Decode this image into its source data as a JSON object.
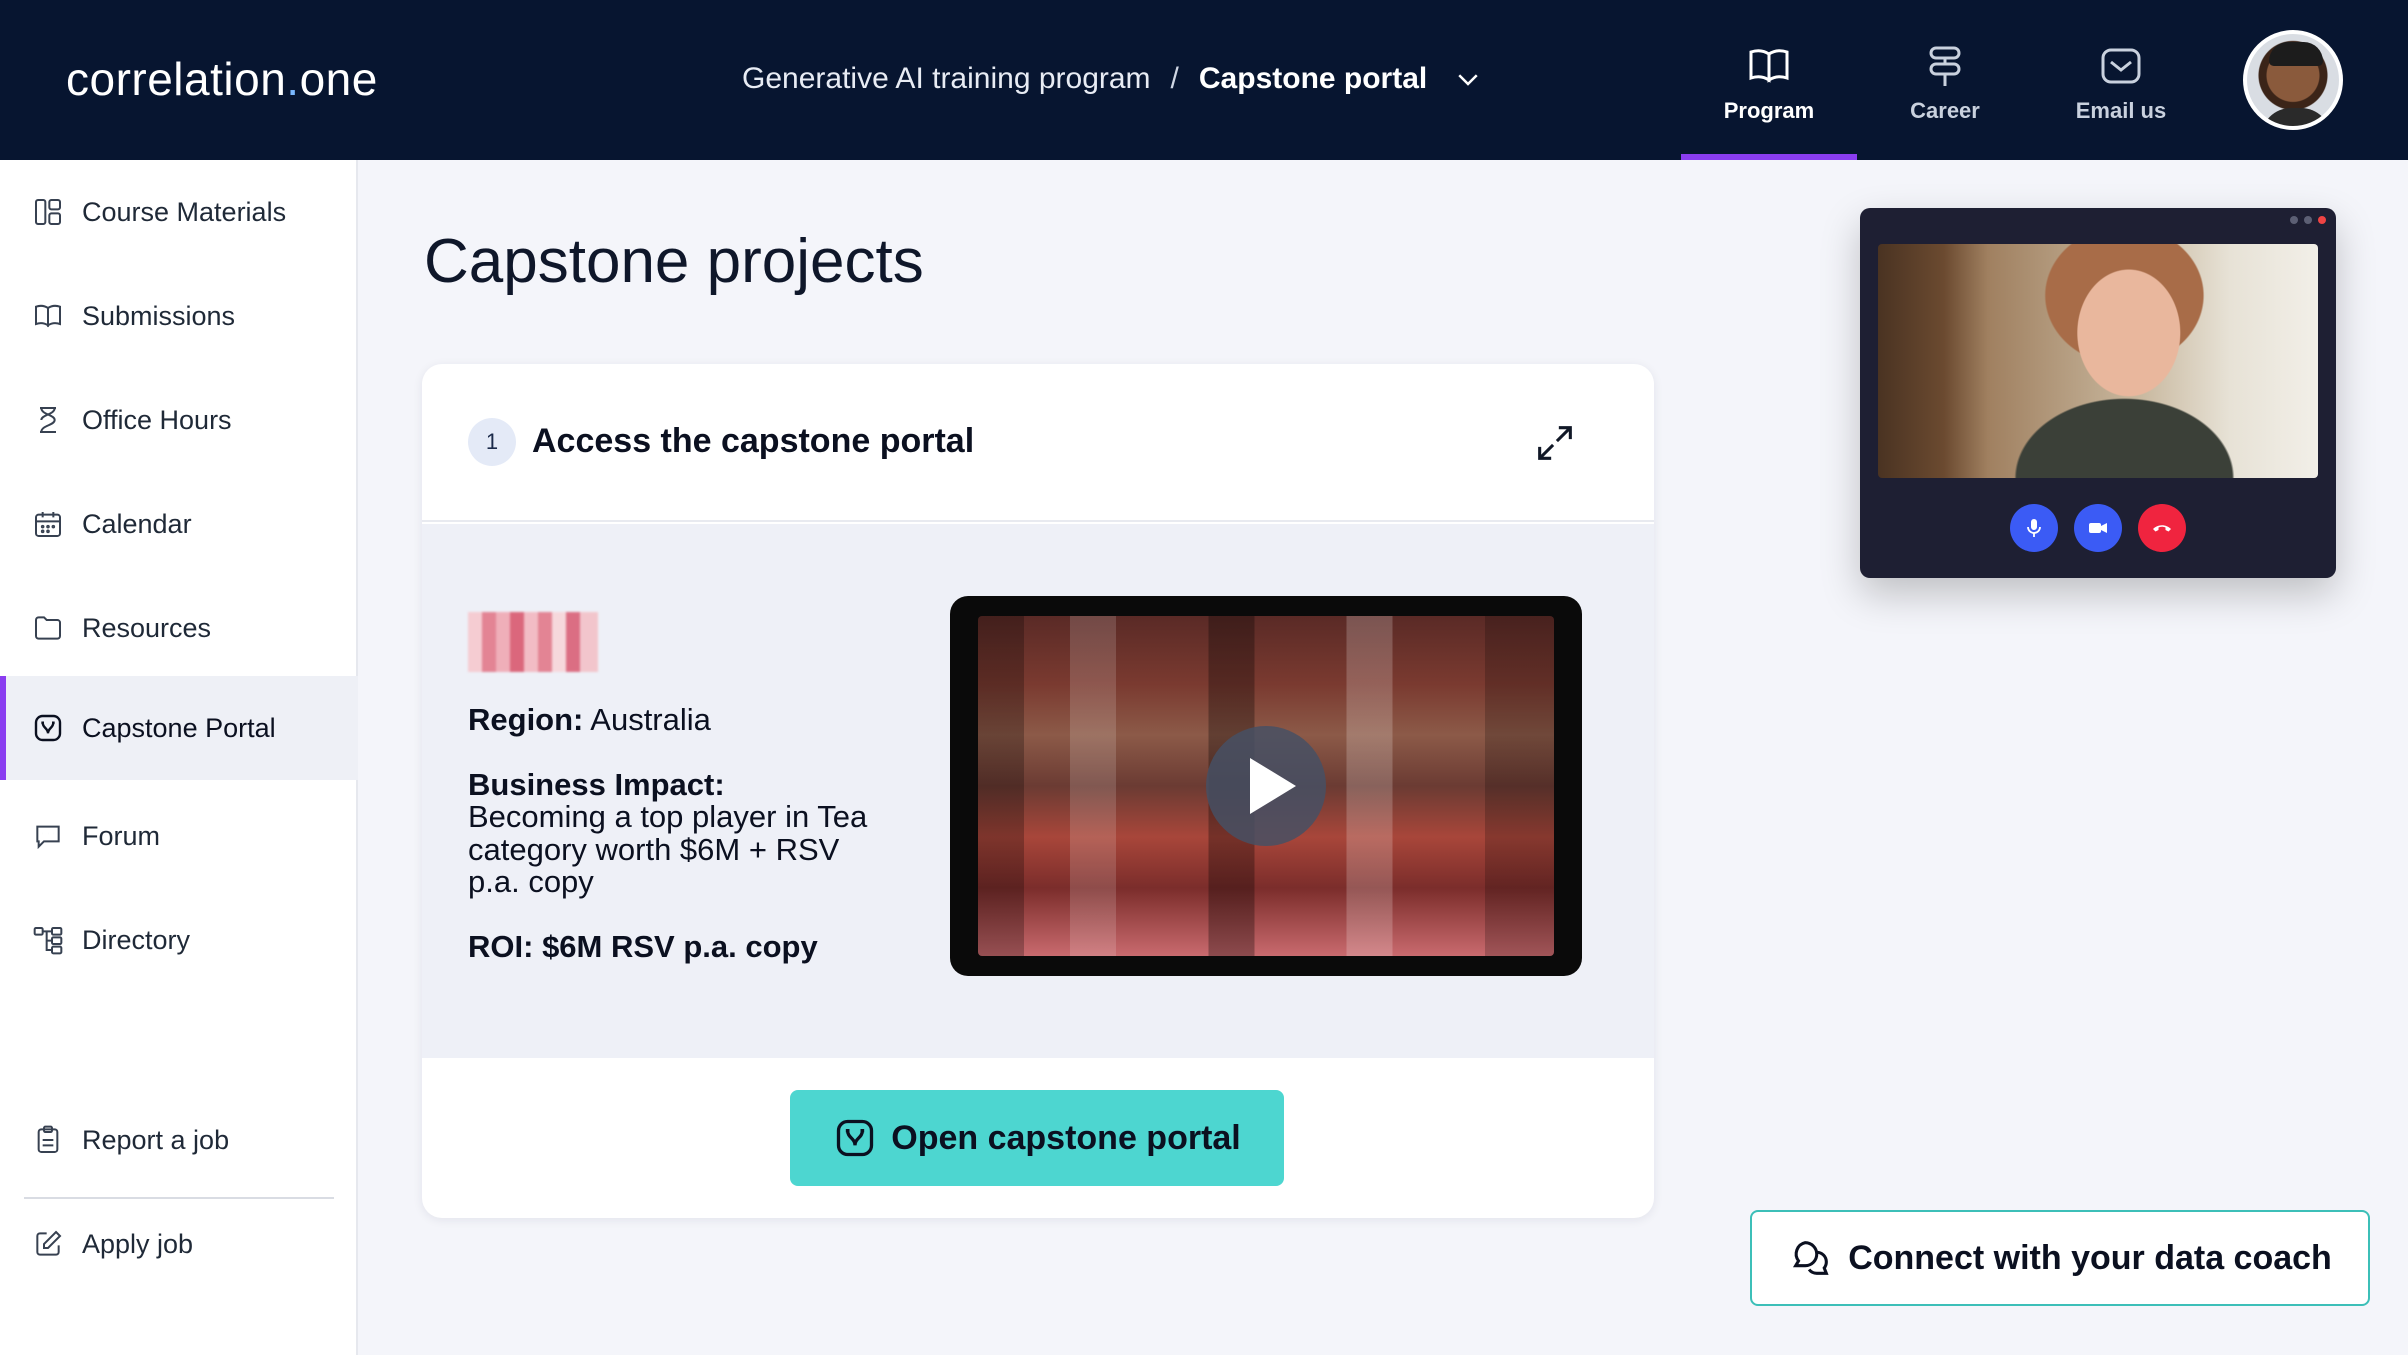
{
  "header": {
    "logo_text_a": "correlation",
    "logo_dot": ".",
    "logo_text_b": "one",
    "breadcrumb_program": "Generative AI training program",
    "breadcrumb_sep": "/",
    "breadcrumb_current": "Capstone portal",
    "nav": [
      {
        "label": "Program",
        "icon": "book-open-icon",
        "active": true
      },
      {
        "label": "Career",
        "icon": "signpost-icon",
        "active": false
      },
      {
        "label": "Email us",
        "icon": "mail-icon",
        "active": false
      }
    ]
  },
  "sidebar": {
    "items": [
      {
        "label": "Course Materials",
        "icon": "layout-icon"
      },
      {
        "label": "Submissions",
        "icon": "book-icon"
      },
      {
        "label": "Office Hours",
        "icon": "hourglass-icon"
      },
      {
        "label": "Calendar",
        "icon": "calendar-icon"
      },
      {
        "label": "Resources",
        "icon": "folder-icon"
      },
      {
        "label": "Capstone Portal",
        "icon": "portal-icon",
        "active": true
      },
      {
        "label": "Forum",
        "icon": "chat-icon"
      },
      {
        "label": "Directory",
        "icon": "tree-icon"
      }
    ],
    "footer_items": [
      {
        "label": "Report a job",
        "icon": "clipboard-icon"
      },
      {
        "label": "Apply job",
        "icon": "edit-icon"
      }
    ]
  },
  "main": {
    "title": "Capstone projects",
    "card": {
      "step": "1",
      "title": "Access the capstone portal",
      "region_label": "Region:",
      "region_value": "Australia",
      "impact_label": "Business Impact:",
      "impact_value": "Becoming a top player in Tea category worth $6M + RSV p.a. copy",
      "roi_label": "ROI:",
      "roi_value": "$6M RSV p.a. copy",
      "button_label": "Open capstone portal"
    }
  },
  "coach_button": "Connect with your data coach",
  "colors": {
    "header_bg": "#071530",
    "accent_purple": "#8a3df0",
    "teal_button": "#4dd6d0",
    "call_blue": "#3b5bf5",
    "call_red": "#f0243f"
  }
}
